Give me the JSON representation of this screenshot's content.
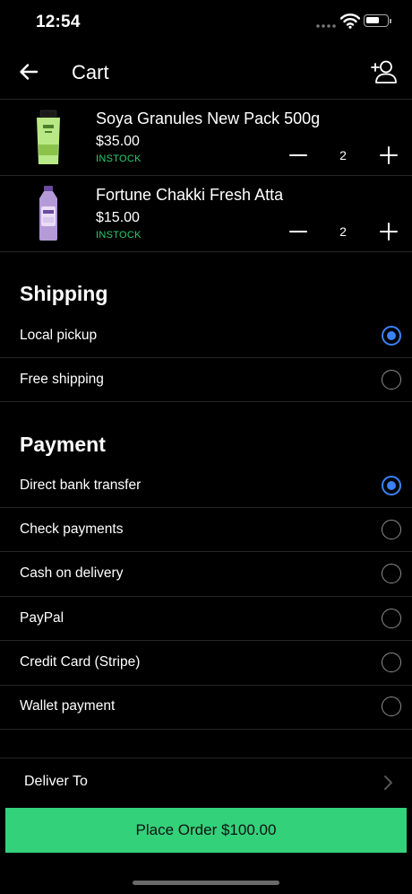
{
  "status_bar": {
    "time": "12:54"
  },
  "header": {
    "title": "Cart"
  },
  "cart": {
    "items": [
      {
        "name": "Soya Granules New Pack 500g",
        "price": "$35.00",
        "stock": "INSTOCK",
        "qty": "2"
      },
      {
        "name": "Fortune Chakki Fresh Atta",
        "price": "$15.00",
        "stock": "INSTOCK",
        "qty": "2"
      }
    ]
  },
  "shipping": {
    "title": "Shipping",
    "options": [
      {
        "label": "Local pickup",
        "selected": true
      },
      {
        "label": "Free shipping",
        "selected": false
      }
    ]
  },
  "payment": {
    "title": "Payment",
    "options": [
      {
        "label": "Direct bank transfer",
        "selected": true
      },
      {
        "label": "Check payments",
        "selected": false
      },
      {
        "label": "Cash on delivery",
        "selected": false
      },
      {
        "label": "PayPal",
        "selected": false
      },
      {
        "label": "Credit Card (Stripe)",
        "selected": false
      },
      {
        "label": "Wallet payment",
        "selected": false
      }
    ]
  },
  "deliver": {
    "label": "Deliver To"
  },
  "place_order": {
    "label": "Place Order $100.00"
  },
  "colors": {
    "accent": "#3a82f7",
    "button": "#33d17a",
    "stock": "#2ecc71",
    "background": "#000000"
  }
}
